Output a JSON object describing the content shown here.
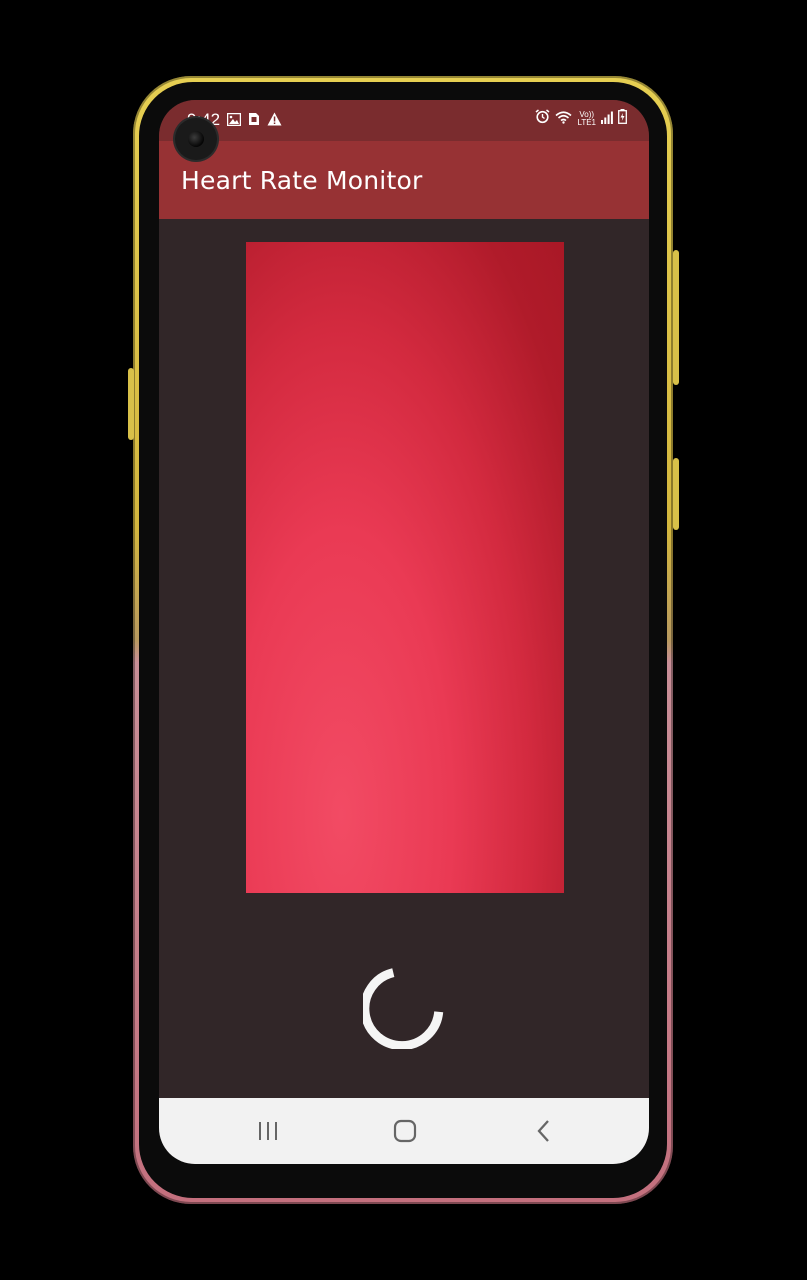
{
  "status_bar": {
    "time": "9:42",
    "left_icons": [
      "image-icon",
      "sim-card-icon",
      "warning-icon"
    ],
    "right_icons": [
      "alarm-icon",
      "wifi-icon",
      "volte-icon",
      "signal-icon",
      "battery-charging-icon"
    ],
    "volte_top": "Vo))",
    "volte_bottom": "LTE1"
  },
  "app": {
    "title": "Heart Rate Monitor"
  },
  "camera_preview": {
    "accent_color": "#e8344f"
  },
  "loading": {
    "spinner_color": "#f5f5f5"
  },
  "nav_bar": {
    "buttons": [
      "recents-icon",
      "home-icon",
      "back-icon"
    ]
  },
  "colors": {
    "status_bar": "#7a2c2e",
    "app_bar": "#973234",
    "background": "#312628",
    "nav_bar": "#f2f2f2"
  }
}
